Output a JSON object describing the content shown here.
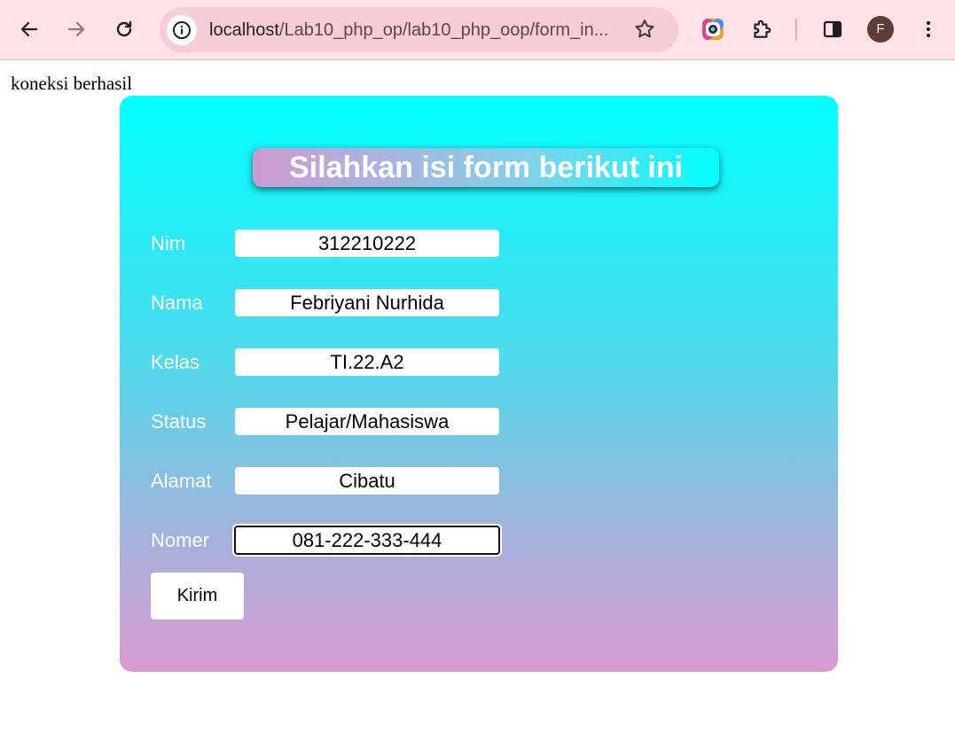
{
  "browser": {
    "url_host": "localhost",
    "url_path": "/Lab10_php_op/lab10_php_oop/form_in...",
    "profile_initial": "F"
  },
  "page": {
    "status_text": "koneksi berhasil"
  },
  "form": {
    "heading": "Silahkan isi form berikut ini",
    "fields": [
      {
        "label": "Nim",
        "value": "312210222"
      },
      {
        "label": "Nama",
        "value": "Febriyani Nurhida"
      },
      {
        "label": "Kelas",
        "value": "TI.22.A2"
      },
      {
        "label": "Status",
        "value": "Pelajar/Mahasiswa"
      },
      {
        "label": "Alamat",
        "value": "Cibatu"
      },
      {
        "label": "Nomer",
        "value": "081-222-333-444"
      }
    ],
    "submit_label": "Kirim"
  },
  "colors": {
    "toolbar_bg": "#ffe1e6",
    "card_top": "#00ffff",
    "card_bottom": "#d99ad0"
  },
  "icons": [
    "back-arrow-icon",
    "forward-arrow-icon",
    "reload-icon",
    "info-icon",
    "star-icon",
    "extension-app-icon",
    "puzzle-icon",
    "side-panel-icon",
    "kebab-menu-icon"
  ]
}
